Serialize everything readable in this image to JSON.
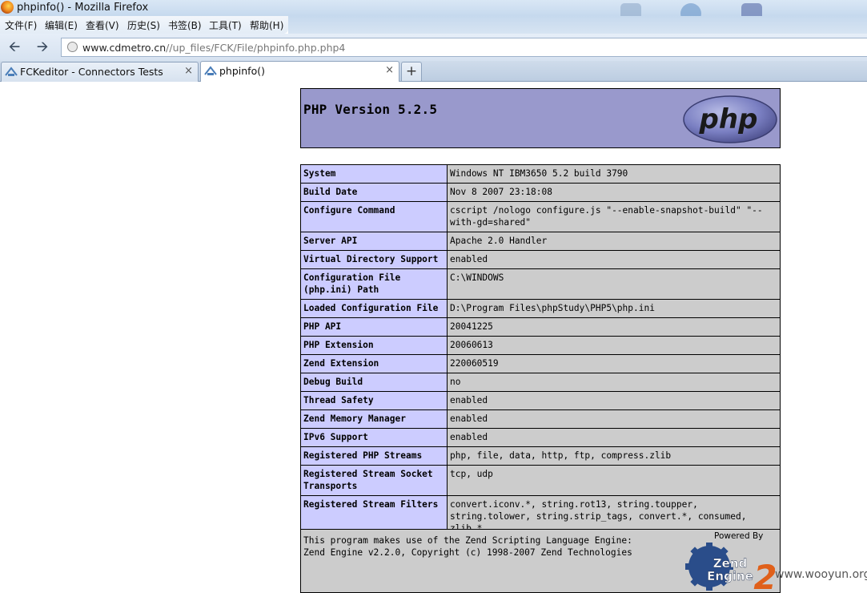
{
  "window": {
    "title": "phpinfo() - Mozilla Firefox"
  },
  "menu": [
    "文件(F)",
    "编辑(E)",
    "查看(V)",
    "历史(S)",
    "书签(B)",
    "工具(T)",
    "帮助(H)"
  ],
  "nav": {
    "back_icon": "back-arrow-icon",
    "forward_icon": "forward-arrow-icon",
    "url_host": "www.cdmetro.cn",
    "url_path": "//up_files/FCK/File/phpinfo.php.php4"
  },
  "tabs": [
    {
      "label": "FCKeditor - Connectors Tests",
      "close": "×",
      "active": false
    },
    {
      "label": "phpinfo()",
      "close": "×",
      "active": true
    }
  ],
  "new_tab_label": "+",
  "php": {
    "version_title": "PHP Version 5.2.5",
    "logo_text": "php",
    "rows": [
      [
        "System",
        "Windows NT IBM3650 5.2 build 3790"
      ],
      [
        "Build Date",
        "Nov 8 2007 23:18:08"
      ],
      [
        "Configure Command",
        "cscript /nologo configure.js \"--enable-snapshot-build\" \"--with-gd=shared\""
      ],
      [
        "Server API",
        "Apache 2.0 Handler"
      ],
      [
        "Virtual Directory Support",
        "enabled"
      ],
      [
        "Configuration File (php.ini) Path",
        "C:\\WINDOWS"
      ],
      [
        "Loaded Configuration File",
        "D:\\Program Files\\phpStudy\\PHP5\\php.ini"
      ],
      [
        "PHP API",
        "20041225"
      ],
      [
        "PHP Extension",
        "20060613"
      ],
      [
        "Zend Extension",
        "220060519"
      ],
      [
        "Debug Build",
        "no"
      ],
      [
        "Thread Safety",
        "enabled"
      ],
      [
        "Zend Memory Manager",
        "enabled"
      ],
      [
        "IPv6 Support",
        "enabled"
      ],
      [
        "Registered PHP Streams",
        "php, file, data, http, ftp, compress.zlib"
      ],
      [
        "Registered Stream Socket Transports",
        "tcp, udp"
      ],
      [
        "Registered Stream Filters",
        "convert.iconv.*, string.rot13, string.toupper, string.tolower, string.strip_tags, convert.*, consumed, zlib.*"
      ]
    ],
    "footer_line1": "This program makes use of the Zend Scripting Language Engine:",
    "footer_line2": "Zend Engine v2.2.0, Copyright (c) 1998-2007 Zend Technologies",
    "powered_by": "Powered By",
    "zend_logo_text": "Zend Engine 2"
  },
  "watermark": "www.wooyun.org",
  "colors": {
    "header_bg": "#9999cc",
    "label_cell_bg": "#ccccff",
    "value_cell_bg": "#cccccc"
  }
}
